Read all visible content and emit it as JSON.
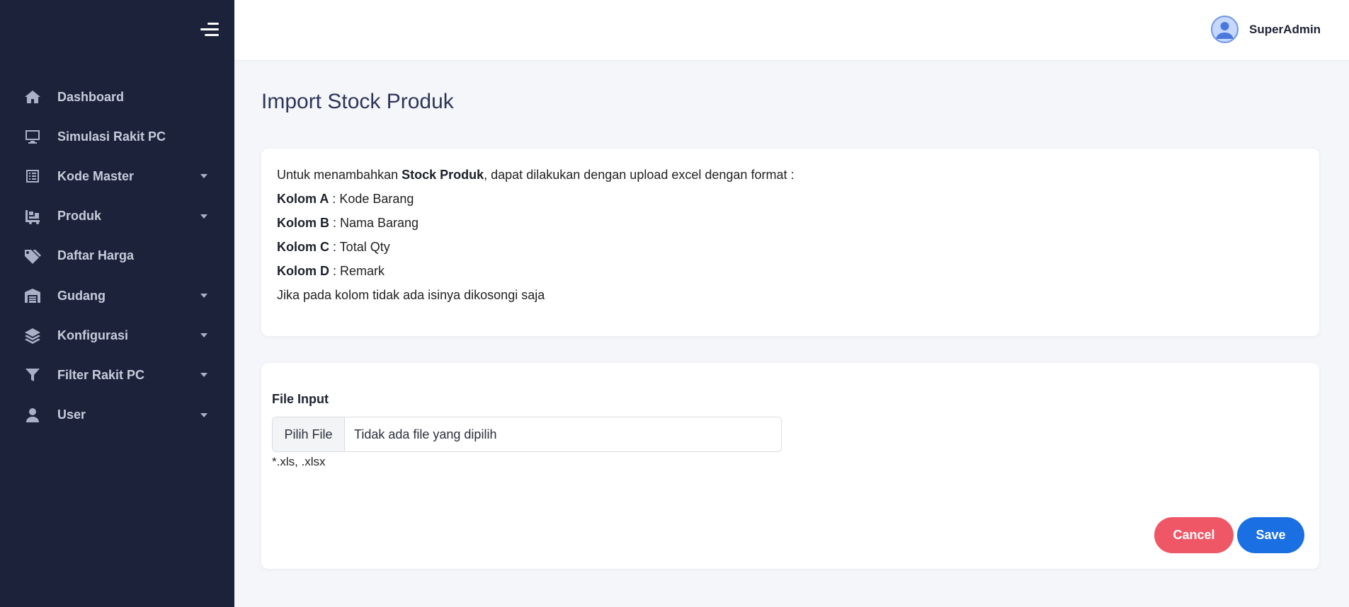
{
  "sidebar": {
    "items": [
      {
        "label": "Dashboard",
        "icon": "home-icon",
        "has_submenu": false
      },
      {
        "label": "Simulasi Rakit PC",
        "icon": "monitor-icon",
        "has_submenu": false
      },
      {
        "label": "Kode Master",
        "icon": "list-icon",
        "has_submenu": true
      },
      {
        "label": "Produk",
        "icon": "dolly-icon",
        "has_submenu": true
      },
      {
        "label": "Daftar Harga",
        "icon": "tags-icon",
        "has_submenu": false
      },
      {
        "label": "Gudang",
        "icon": "warehouse-icon",
        "has_submenu": true
      },
      {
        "label": "Konfigurasi",
        "icon": "layers-icon",
        "has_submenu": true
      },
      {
        "label": "Filter Rakit PC",
        "icon": "filter-icon",
        "has_submenu": true
      },
      {
        "label": "User",
        "icon": "user-icon",
        "has_submenu": true
      }
    ]
  },
  "header": {
    "username": "SuperAdmin",
    "avatar_icon": "user-avatar-icon"
  },
  "main": {
    "title": "Import Stock Produk",
    "info": {
      "intro_prefix": "Untuk menambahkan ",
      "intro_bold": "Stock Produk",
      "intro_suffix": ", dapat dilakukan dengan upload excel dengan format :",
      "columns": [
        {
          "key": "Kolom A",
          "value": " : Kode Barang"
        },
        {
          "key": "Kolom B",
          "value": " : Nama Barang"
        },
        {
          "key": "Kolom C",
          "value": " : Total Qty"
        },
        {
          "key": "Kolom D",
          "value": " : Remark"
        }
      ],
      "note": "Jika pada kolom tidak ada isinya dikosongi saja"
    },
    "form": {
      "file_label": "File Input",
      "choose_button": "Pilih File",
      "file_status": "Tidak ada file yang dipilih",
      "hint": "*.xls, .xlsx",
      "cancel_label": "Cancel",
      "save_label": "Save"
    }
  },
  "colors": {
    "sidebar_bg": "#1c223a",
    "cancel": "#ef5766",
    "save": "#1a6fe3",
    "page_bg": "#f5f6fa"
  }
}
